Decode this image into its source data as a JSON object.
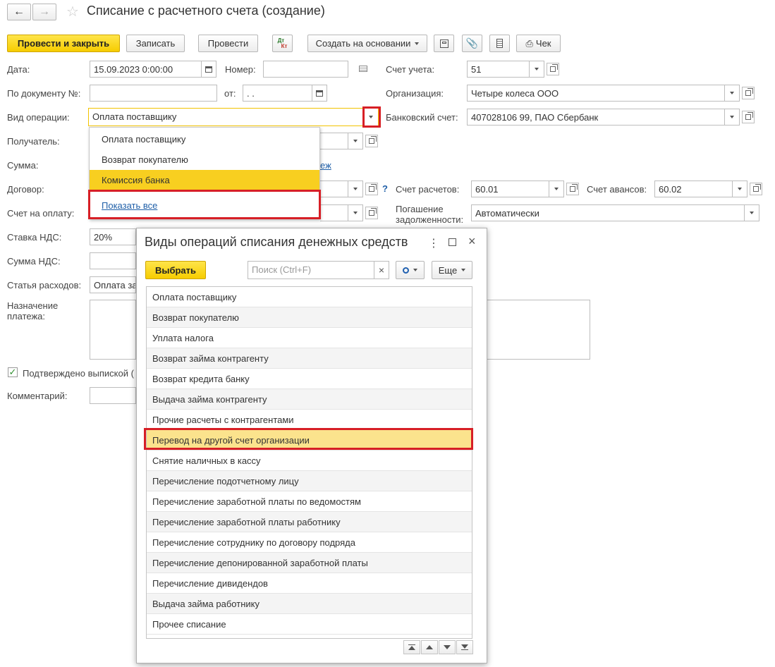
{
  "window": {
    "title": "Списание с расчетного счета (создание)"
  },
  "toolbar": {
    "post_close": "Провести и закрыть",
    "save": "Записать",
    "post": "Провести",
    "dtkt_top": "Дт",
    "dtkt_bottom": "Кт",
    "create_based": "Создать на основании",
    "check": "Чек"
  },
  "form": {
    "date_label": "Дата:",
    "date_value": "15.09.2023  0:00:00",
    "number_label": "Номер:",
    "number_value": "",
    "account_label": "Счет учета:",
    "account_value": "51",
    "doc_no_label": "По документу №:",
    "doc_no_value": "",
    "from_label": "от:",
    "from_value": " .  .",
    "org_label": "Организация:",
    "org_value": "Четыре колеса ООО",
    "op_type_label": "Вид операции:",
    "op_type_value": "Оплата поставщику",
    "bank_account_label": "Банковский счет:",
    "bank_account_value": "407028106                     99, ПАО Сбербанк",
    "recipient_label": "Получатель:",
    "amount_label": "Сумма:",
    "amount_link": "еж",
    "contract_label": "Договор:",
    "help_q": "?",
    "settle_label": "Счет расчетов:",
    "settle_value": "60.01",
    "advance_label": "Счет авансов:",
    "advance_value": "60.02",
    "invoice_label": "Счет на оплату:",
    "repay_label_1": "Погашение",
    "repay_label_2": "задолженности:",
    "repay_value": "Автоматически",
    "vat_rate_label": "Ставка НДС:",
    "vat_rate_value": "20%",
    "vat_sum_label": "Сумма НДС:",
    "expense_label": "Статья расходов:",
    "expense_value": "Оплата за",
    "purpose_label_1": "Назначение",
    "purpose_label_2": "платежа:",
    "confirmed_label": "Подтверждено выпиской (",
    "comment_label": "Комментарий:"
  },
  "dropdown": {
    "items": [
      "Оплата поставщику",
      "Возврат покупателю",
      "Комиссия банка"
    ],
    "active_index": 2,
    "show_all": "Показать все"
  },
  "modal": {
    "title": "Виды операций списания денежных средств",
    "select_button": "Выбрать",
    "search_placeholder": "Поиск (Ctrl+F)",
    "more_button": "Еще",
    "rows": [
      "Оплата поставщику",
      "Возврат покупателю",
      "Уплата налога",
      "Возврат займа контрагенту",
      "Возврат кредита банку",
      "Выдача займа контрагенту",
      "Прочие расчеты с контрагентами",
      "Перевод на другой счет организации",
      "Снятие наличных в кассу",
      "Перечисление подотчетному лицу",
      "Перечисление заработной платы по ведомостям",
      "Перечисление заработной платы работнику",
      "Перечисление сотруднику по договору подряда",
      "Перечисление депонированной заработной платы",
      "Перечисление дивидендов",
      "Выдача займа работнику",
      "Прочее списание"
    ],
    "selected_index": 7
  },
  "colors": {
    "accent_yellow": "#f8cf20",
    "selection": "#fbe38d",
    "highlight_red": "#d71f26",
    "link_blue": "#1f5fa8"
  }
}
